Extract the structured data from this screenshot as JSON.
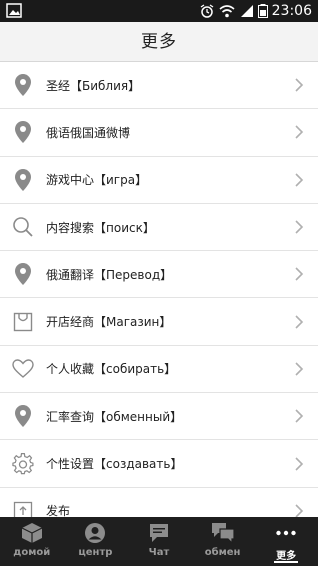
{
  "status_bar": {
    "time": "23:06"
  },
  "header": {
    "title": "更多"
  },
  "list": [
    {
      "label": "圣经【Библия】",
      "icon": "location-pin-icon"
    },
    {
      "label": "俄语俄国通微博",
      "icon": "location-pin-icon"
    },
    {
      "label": "游戏中心【игра】",
      "icon": "location-pin-icon"
    },
    {
      "label": "内容搜索【поиск】",
      "icon": "search-icon"
    },
    {
      "label": "俄通翻译【Перевод】",
      "icon": "location-pin-icon"
    },
    {
      "label": "开店经商【Магазин】",
      "icon": "shopping-bag-icon"
    },
    {
      "label": "个人收藏【собирать】",
      "icon": "heart-icon"
    },
    {
      "label": "汇率查询【обменный】",
      "icon": "location-pin-icon"
    },
    {
      "label": "个性设置【создавать】",
      "icon": "gear-icon"
    },
    {
      "label": "发布",
      "icon": "upload-icon"
    }
  ],
  "tab_bar": {
    "tabs": [
      {
        "label": "домой",
        "icon": "box-icon",
        "active": false
      },
      {
        "label": "центр",
        "icon": "user-icon",
        "active": false
      },
      {
        "label": "Чат",
        "icon": "chat-bubble-icon",
        "active": false
      },
      {
        "label": "обмен",
        "icon": "chat-double-icon",
        "active": false
      },
      {
        "label": "更多",
        "icon": "more-dots-icon",
        "active": true
      }
    ]
  },
  "colors": {
    "status_bar_bg": "#1a1a1a",
    "title_bar_bg": "#f3f3f3",
    "tab_bar_bg": "#1f1f1f",
    "icon_gray": "#8a8a8a"
  }
}
